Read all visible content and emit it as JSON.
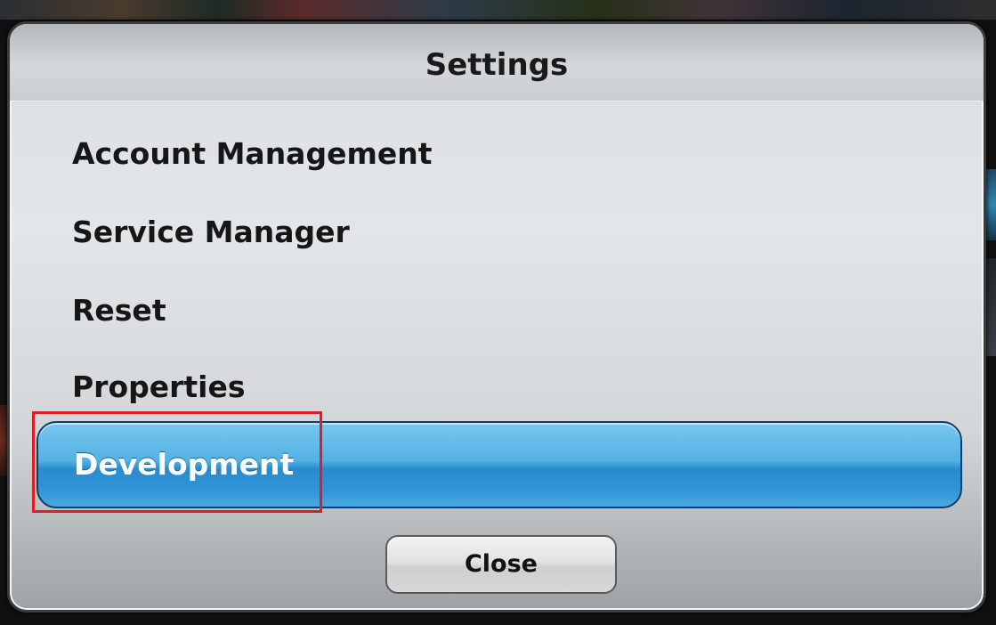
{
  "dialog": {
    "title": "Settings",
    "items": [
      {
        "label": "Account Management"
      },
      {
        "label": "Service Manager"
      },
      {
        "label": "Reset"
      },
      {
        "label": "Properties"
      },
      {
        "label": "Development",
        "selected": true
      }
    ],
    "close_label": "Close"
  },
  "colors": {
    "selection": "#2f95d6",
    "annotation_box": "#e01d23",
    "dialog_background": "#e3e6e9"
  }
}
